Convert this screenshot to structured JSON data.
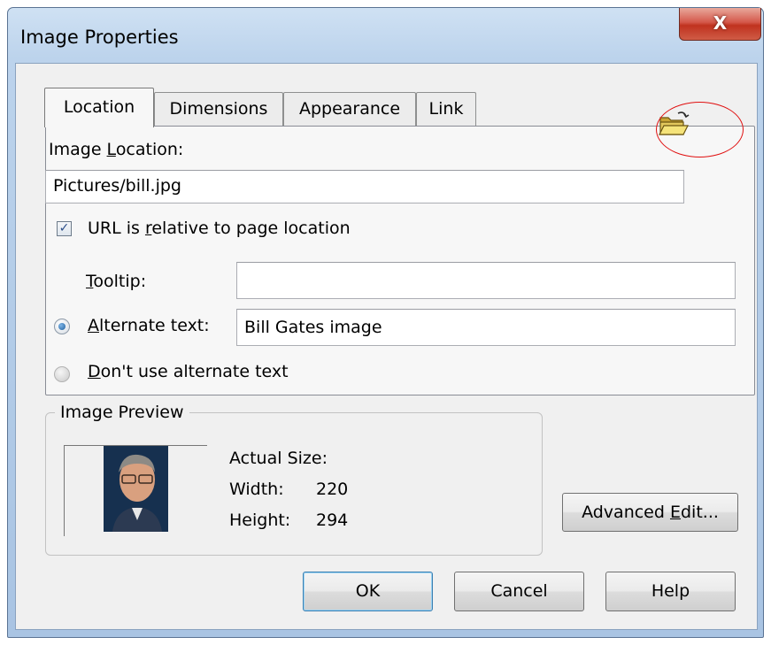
{
  "window": {
    "title": "Image Properties",
    "close_label": "X"
  },
  "tabs": [
    {
      "label": "Location",
      "active": true
    },
    {
      "label": "Dimensions",
      "active": false
    },
    {
      "label": "Appearance",
      "active": false
    },
    {
      "label": "Link",
      "active": false
    }
  ],
  "location": {
    "image_location_label_pre": "Image ",
    "image_location_label_u": "L",
    "image_location_label_post": "ocation:",
    "image_location_value": "Pictures/bill.jpg",
    "browse_icon": "open-folder-icon",
    "url_relative_checked": true,
    "url_relative_pre": "URL is ",
    "url_relative_u": "r",
    "url_relative_post": "elative to page location",
    "tooltip_label_u": "T",
    "tooltip_label_post": "ooltip:",
    "tooltip_value": "",
    "alt_text_selected": true,
    "alt_text_label_u": "A",
    "alt_text_label_post": "lternate text:",
    "alt_text_value": "Bill Gates image",
    "no_alt_label_u": "D",
    "no_alt_label_post": "on't use alternate text"
  },
  "preview": {
    "group_title": "Image Preview",
    "actual_size_label": "Actual Size:",
    "width_label": "Width:",
    "width_value": "220",
    "height_label": "Height:",
    "height_value": "294"
  },
  "buttons": {
    "advanced_edit_pre": "Advanced ",
    "advanced_edit_u": "E",
    "advanced_edit_post": "dit...",
    "ok": "OK",
    "cancel": "Cancel",
    "help": "Help"
  },
  "colors": {
    "highlight_circle": "#e01010",
    "close_button": "#c0321f",
    "frame": "#a9c4e3"
  }
}
